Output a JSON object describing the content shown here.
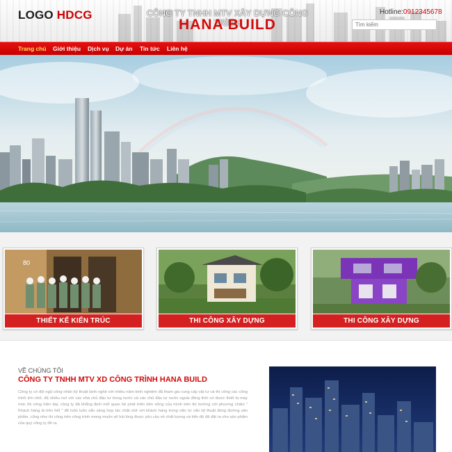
{
  "header": {
    "logo_text": "LOGO",
    "logo_accent": "HDCG",
    "company_line": "CÔNG TY TNHH MTV XÂY DỰNG CÔNG TRÌNH",
    "brand": "HANA BUILD",
    "hotline_label": "Hotline:",
    "hotline_number": "0912345678",
    "search_placeholder": "Tìm kiếm"
  },
  "nav": {
    "items": [
      {
        "label": "Trang chủ",
        "active": true
      },
      {
        "label": "Giới thiệu"
      },
      {
        "label": "Dịch vụ"
      },
      {
        "label": "Dự án"
      },
      {
        "label": "Tin tức"
      },
      {
        "label": "Liên hệ"
      }
    ]
  },
  "services": [
    {
      "label": "THIẾT KẾ KIẾN TRÚC"
    },
    {
      "label": "THI CÔNG XÂY DỰNG"
    },
    {
      "label": "THI CÔNG XÂY DỰNG"
    }
  ],
  "about": {
    "subtitle": "VỀ CHÚNG TÔI",
    "title": "CÔNG TY TNHH MTV XD CÔNG TRÌNH HANA BUILD",
    "body": "Công ty có đội ngũ công nhân kỹ thuật lành nghề với nhiều năm kinh nghiệm đã tham gia cung cấp vật tư và thi công các công trình lớn nhỏ, đã nhiều nơi với các nhà chủ đầu tư trong nước và các chủ đầu tư nước ngoài đồng thời có được thiết bị máy móc thi công hiện đại, công ty đã khẳng định mối quan hệ phát triển bền vững của mình trên thị trường với phương châm \" Khách hàng là trên hết \" để luôn luôn sẵn sàng hợp tác chặt chẽ với khách hàng trong việc tư vấn kỹ thuật đúng đường sản phẩm, cũng như thi công trên công trình mong muốn sẽ hài lòng được yêu cầu về chất lượng và tiến độ đã đặt ra cho sản phẩm của quý công ty đề ra."
  },
  "colors": {
    "brand_red": "#d10a0a",
    "nav_red": "#d90000",
    "nav_active": "#ffe05a",
    "text_gray": "#9a9a9a"
  }
}
